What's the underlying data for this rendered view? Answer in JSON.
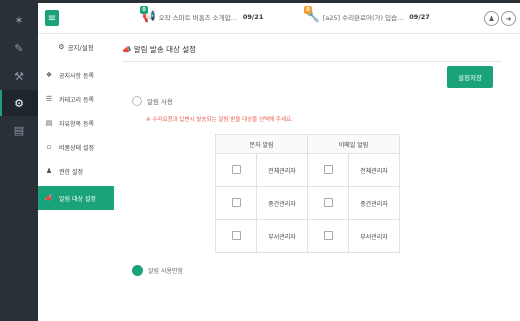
{
  "icons": {
    "menu": "hamburger-icon",
    "bell": "bell-icon",
    "wrench": "wrench-icon",
    "user": "user-icon",
    "logout": "logout-icon"
  },
  "colors": {
    "accent": "#1aa37a",
    "warning": "#e45b4e",
    "sidebar_dark": "#2a3038"
  },
  "header": {
    "notice1": {
      "badge": "0",
      "text": "오작 스마트 버홈즈 소개합...",
      "date": "09/21"
    },
    "notice2": {
      "badge": "0",
      "text": "[a25] 수리완료어(가) 입습...",
      "date": "09/27"
    }
  },
  "sidebar": {
    "title": "공지/설정",
    "items": [
      {
        "label": "공지사항 등록"
      },
      {
        "label": "카테고리 등록"
      },
      {
        "label": "자유항목 등록"
      },
      {
        "label": "비품상태 설정"
      },
      {
        "label": "권한 설정"
      },
      {
        "label": "알림 대상 설정"
      }
    ]
  },
  "main": {
    "title": "알림 발송 대상 설정",
    "save_label": "설정저장",
    "radio_label": "알림 사용",
    "warning": "※ 수리요청과 답변시 발송되는 알림 받을 대상을 선택해 주세요.",
    "table": {
      "headers": [
        "문자 알림",
        "이메일 알림"
      ],
      "rows": [
        {
          "sms": "전체관리자",
          "email": "전체관리자"
        },
        {
          "sms": "중간관리자",
          "email": "중간관리자"
        },
        {
          "sms": "부서관리자",
          "email": "부서관리자"
        }
      ]
    },
    "radio2_label": "알림 사용안함"
  }
}
